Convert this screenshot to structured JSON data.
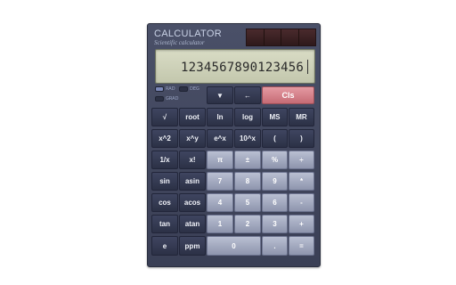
{
  "brand": {
    "title": "CALCULATOR",
    "subtitle": "Scientific calculator"
  },
  "display": {
    "value": "1234567890123456"
  },
  "modes": [
    {
      "label": "RAD",
      "active": true
    },
    {
      "label": "DEG",
      "active": false
    },
    {
      "label": "GRAD",
      "active": false
    }
  ],
  "controls": {
    "down": "▼",
    "back": "←",
    "clear": "Cls"
  },
  "keys": {
    "sqrt": "√",
    "root": "root",
    "ln": "ln",
    "log": "log",
    "ms": "MS",
    "mr": "MR",
    "x2": "x^2",
    "xy": "x^y",
    "ex": "e^x",
    "tenx": "10^x",
    "lparen": "(",
    "rparen": ")",
    "inv": "1/x",
    "fact": "x!",
    "pi": "π",
    "pm": "±",
    "pct": "%",
    "div": "÷",
    "sin": "sin",
    "asin": "asin",
    "d7": "7",
    "d8": "8",
    "d9": "9",
    "mul": "*",
    "cos": "cos",
    "acos": "acos",
    "d4": "4",
    "d5": "5",
    "d6": "6",
    "sub": "-",
    "tan": "tan",
    "atan": "atan",
    "d1": "1",
    "d2": "2",
    "d3": "3",
    "add": "+",
    "e": "e",
    "ppm": "ppm",
    "d0": "0",
    "dot": ".",
    "eq": "="
  },
  "colors": {
    "body": "#3f4560",
    "display": "#cfd3b9",
    "clear": "#d07c86",
    "light_key": "#a4abc2"
  }
}
